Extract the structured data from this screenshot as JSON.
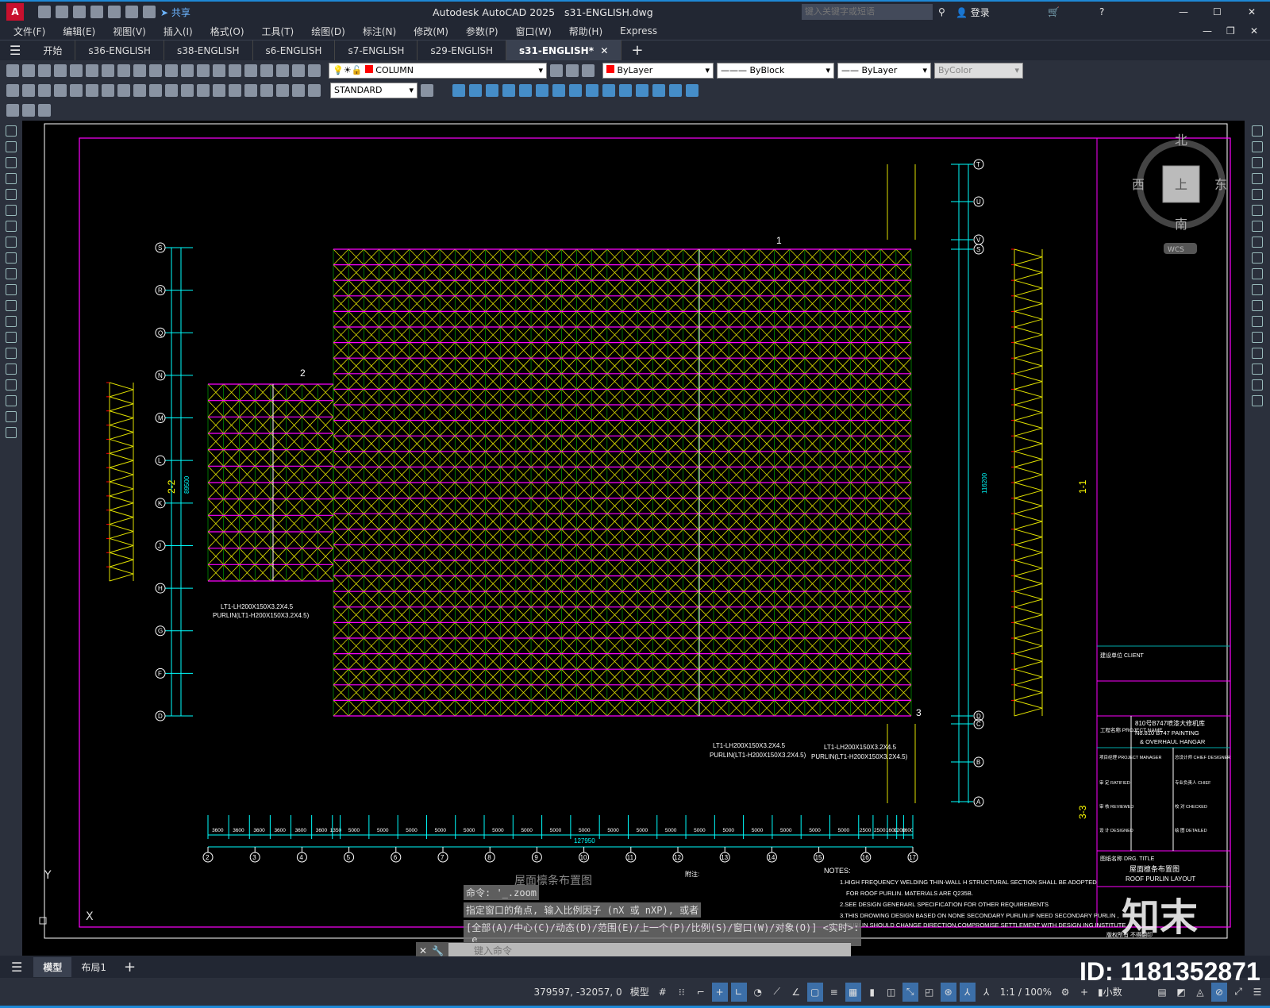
{
  "app": {
    "title": "Autodesk AutoCAD 2025",
    "file": "s31-ENGLISH.dwg",
    "share": "共享",
    "search_placeholder": "键入关键字或短语",
    "login": "登录"
  },
  "menu": [
    "文件(F)",
    "编辑(E)",
    "视图(V)",
    "插入(I)",
    "格式(O)",
    "工具(T)",
    "绘图(D)",
    "标注(N)",
    "修改(M)",
    "参数(P)",
    "窗口(W)",
    "帮助(H)",
    "Express"
  ],
  "tabs": [
    {
      "label": "开始"
    },
    {
      "label": "s36-ENGLISH"
    },
    {
      "label": "s38-ENGLISH"
    },
    {
      "label": "s6-ENGLISH"
    },
    {
      "label": "s7-ENGLISH"
    },
    {
      "label": "s29-ENGLISH"
    },
    {
      "label": "s31-ENGLISH*",
      "active": true
    }
  ],
  "properties": {
    "layer": "COLUMN",
    "layer_color": "#ff0000",
    "color": "ByLayer",
    "linetype": "ByBlock",
    "lineweight": "ByLayer",
    "plotstyle": "ByColor",
    "textstyle": "STANDARD"
  },
  "viewcube": {
    "north": "北",
    "south": "南",
    "east": "东",
    "west": "西",
    "top": "上",
    "wcs": "WCS"
  },
  "drawing": {
    "colors": {
      "chord": "#ff00ff",
      "web": "#e0e000",
      "node": "#00ff00",
      "dim": "#00ffff",
      "frame": "#ff00ff"
    },
    "bottom_dims": [
      "3600",
      "3600",
      "3600",
      "3600",
      "3600",
      "3600",
      "1350",
      "5000",
      "5000",
      "5000",
      "5000",
      "5000",
      "5000",
      "5000",
      "5000",
      "5000",
      "5000",
      "5000",
      "5000",
      "5000",
      "5000",
      "5000",
      "5000",
      "5000",
      "5000",
      "2500",
      "2500",
      "1600",
      "1200",
      "1600"
    ],
    "bottom_total": "127950",
    "bottom_axes": [
      "2",
      "3",
      "4",
      "5",
      "6",
      "7",
      "8",
      "9",
      "10",
      "11",
      "12",
      "13",
      "14",
      "15",
      "16",
      "17"
    ],
    "left_axes": [
      "S",
      "R",
      "Q",
      "N",
      "M",
      "L",
      "K",
      "J",
      "H",
      "G",
      "F",
      "D"
    ],
    "right_axes": [
      "T",
      "U",
      "V",
      "S",
      "D",
      "C",
      "B",
      "A"
    ],
    "right_total": "116200",
    "left_total": "89500",
    "purlin_label_1": "LT1-LH200X150X3.2X4.5",
    "purlin_label_2": "PURLIN(LT1-H200X150X3.2X4.5)",
    "section_marks": [
      "1",
      "2",
      "3",
      "1-1",
      "2-2",
      "3-3"
    ],
    "title_cn": "屋面檩条布置图",
    "title_en": "ROOF PURLIN LAYOUT",
    "notes_heading": "NOTES:",
    "notes": [
      "1.HIGH  FREQUENCY WELDING THIN-WALL H STRUCTURAL SECTION SHALL BE ADOPTED",
      "FOR ROOF PURLIN. MATERIALS ARE Q235B.",
      "2.SEE DESIGN GENERARL SPECIFICATION FOR OTHER REQUIREMENTS",
      "3.THIS DROWING DESIGN BASED ON NONE SECONDARY PURLIN.IF NEED  SECONDARY PURLIN ,",
      "PURLIN SHOULD CHANGE DIRECTION,COMPROMISE SETTLEMENT WITH  DESIGN ING INSTITUTE"
    ],
    "notes_cn_heading": "附注:",
    "title_block": {
      "client": "建设单位 CLIENT",
      "project_label": "工程名称 PROJECT NAME",
      "project_cn": "810号B747喷漆大修机库",
      "project_en1": "No.810 B747 PAINTING",
      "project_en2": "& OVERHAUL HANGAR",
      "rows": [
        "项目经理 PROJECT MANAGER",
        "总设计师 CHIEF DESIGNER",
        "审 定 RATIFIED",
        "专业负责人 CHIEF",
        "审 核 REVIEWED",
        "校 对 CHECKED",
        "设 计 DESIGNED",
        "绘 图 DETAILED"
      ],
      "drg_title": "图纸名称 DRG. TITLE",
      "copyright": "版权所有 不得翻印"
    }
  },
  "command": {
    "history": [
      "命令: '_.zoom",
      "指定窗口的角点, 输入比例因子 (nX 或 nXP), 或者",
      "[全部(A)/中心(C)/动态(D)/范围(E)/上一个(P)/比例(S)/窗口(W)/对象(O)] <实时>:",
      "_e"
    ],
    "placeholder": "键入命令"
  },
  "layout_tabs": [
    "模型",
    "布局1"
  ],
  "status": {
    "coords": "379597, -32057, 0",
    "space": "模型",
    "scale": "1:1 / 100%",
    "units": "小数"
  },
  "watermark": {
    "id": "ID: 1181352871",
    "logo": "知末"
  }
}
